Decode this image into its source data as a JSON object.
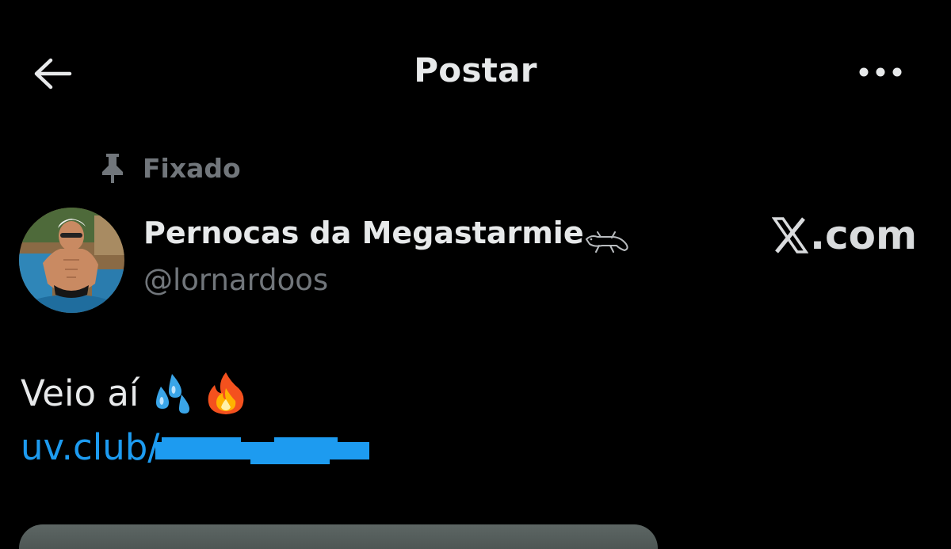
{
  "header": {
    "title": "Postar",
    "back_icon": "arrow-left-icon",
    "more_icon": "more-horizontal-icon"
  },
  "post": {
    "pinned_label": "Fixado",
    "author": {
      "display_name": "Pernocas da Megastarmie",
      "handle": "@lornardoos",
      "badge_icon": "gecko-icon"
    },
    "watermark": ".com",
    "text": "Veio aí",
    "emojis": [
      "sweat-droplets-emoji",
      "fire-emoji"
    ],
    "link_text": "uv.club/"
  },
  "colors": {
    "background": "#000000",
    "text_primary": "#e7e9ea",
    "text_secondary": "#71767b",
    "link": "#1d9bf0"
  }
}
